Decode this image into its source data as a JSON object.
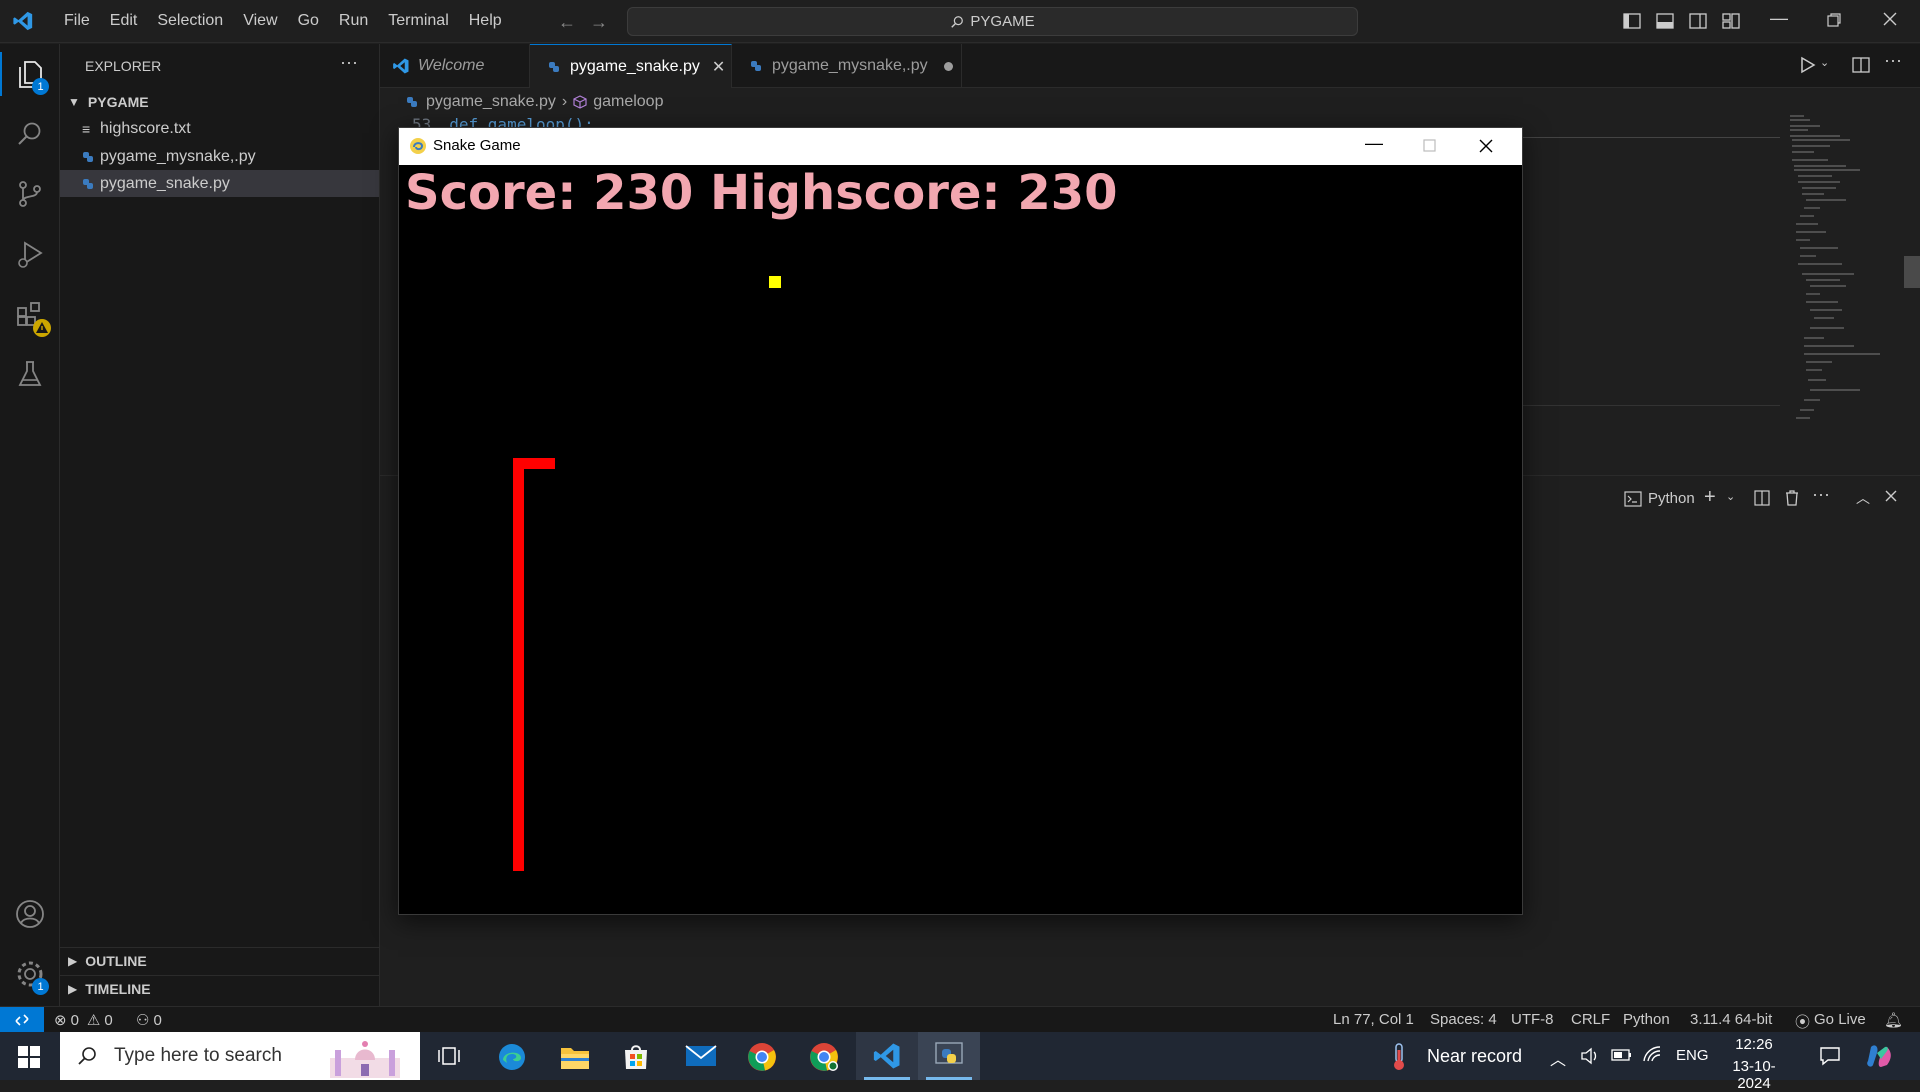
{
  "menu": [
    "File",
    "Edit",
    "Selection",
    "View",
    "Go",
    "Run",
    "Terminal",
    "Help"
  ],
  "command_center": "PYGAME",
  "explorer": {
    "title": "EXPLORER",
    "folder": "PYGAME",
    "files": [
      {
        "name": "highscore.txt",
        "type": "text"
      },
      {
        "name": "pygame_mysnake,.py",
        "type": "python"
      },
      {
        "name": "pygame_snake.py",
        "type": "python",
        "selected": true
      }
    ],
    "outline": "OUTLINE",
    "timeline": "TIMELINE"
  },
  "activity_badges": {
    "explorer": "1",
    "settings": "1"
  },
  "tabs": [
    {
      "label": "Welcome",
      "italic": true
    },
    {
      "label": "pygame_snake.py",
      "active": true
    },
    {
      "label": "pygame_mysnake,.py",
      "dirty": true
    }
  ],
  "breadcrumb": {
    "file": "pygame_snake.py",
    "symbol": "gameloop"
  },
  "code_peek": "def gameloop():",
  "terminal": {
    "label": "Python"
  },
  "game": {
    "window_title": "Snake Game",
    "score_text": "Score: 230  Highscore: 230",
    "colors": {
      "snake": "#ff0000",
      "food": "#ffff00",
      "score": "#f2a7b0",
      "background": "#000000"
    }
  },
  "status": {
    "errors": "0",
    "warnings": "0",
    "ports": "0",
    "position": "Ln 77, Col 1",
    "spaces": "Spaces: 4",
    "encoding": "UTF-8",
    "eol": "CRLF",
    "language": "Python",
    "interpreter": "3.11.4 64-bit",
    "golive": "Go Live"
  },
  "taskbar": {
    "search_placeholder": "Type here to search",
    "weather": "Near record",
    "lang": "ENG",
    "time": "12:26",
    "date": "13-10-2024"
  }
}
